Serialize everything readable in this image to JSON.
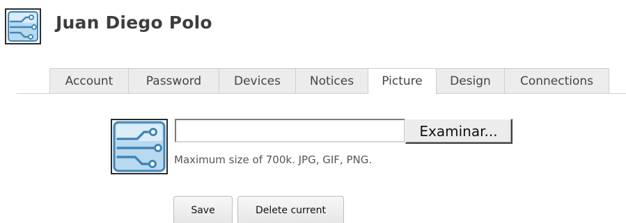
{
  "profile": {
    "name": "Juan Diego Polo",
    "avatar_icon": "circuit-board-icon"
  },
  "tabs": [
    {
      "label": "Account",
      "active": false
    },
    {
      "label": "Password",
      "active": false
    },
    {
      "label": "Devices",
      "active": false
    },
    {
      "label": "Notices",
      "active": false
    },
    {
      "label": "Picture",
      "active": true
    },
    {
      "label": "Design",
      "active": false
    },
    {
      "label": "Connections",
      "active": false
    }
  ],
  "upload": {
    "file_value": "",
    "browse_label": "Examinar...",
    "hint": "Maximum size of 700k. JPG, GIF, PNG."
  },
  "actions": {
    "save_label": "Save",
    "delete_label": "Delete current"
  },
  "colors": {
    "icon_blue": "#3f86b8",
    "icon_light": "#b9d9ef",
    "tab_bg": "#ececec",
    "border": "#cfcfcf"
  }
}
